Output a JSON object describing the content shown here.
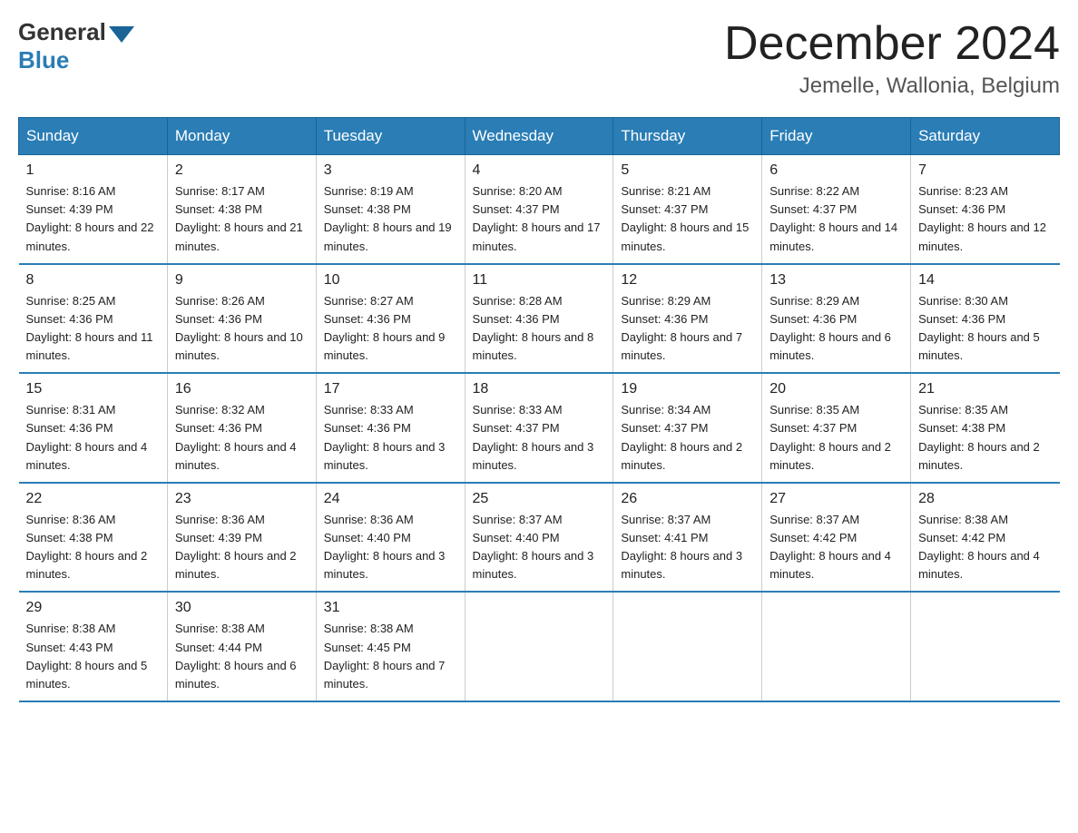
{
  "logo": {
    "general": "General",
    "blue": "Blue"
  },
  "title": "December 2024",
  "location": "Jemelle, Wallonia, Belgium",
  "days_of_week": [
    "Sunday",
    "Monday",
    "Tuesday",
    "Wednesday",
    "Thursday",
    "Friday",
    "Saturday"
  ],
  "weeks": [
    [
      {
        "day": "1",
        "sunrise": "8:16 AM",
        "sunset": "4:39 PM",
        "daylight": "8 hours and 22 minutes."
      },
      {
        "day": "2",
        "sunrise": "8:17 AM",
        "sunset": "4:38 PM",
        "daylight": "8 hours and 21 minutes."
      },
      {
        "day": "3",
        "sunrise": "8:19 AM",
        "sunset": "4:38 PM",
        "daylight": "8 hours and 19 minutes."
      },
      {
        "day": "4",
        "sunrise": "8:20 AM",
        "sunset": "4:37 PM",
        "daylight": "8 hours and 17 minutes."
      },
      {
        "day": "5",
        "sunrise": "8:21 AM",
        "sunset": "4:37 PM",
        "daylight": "8 hours and 15 minutes."
      },
      {
        "day": "6",
        "sunrise": "8:22 AM",
        "sunset": "4:37 PM",
        "daylight": "8 hours and 14 minutes."
      },
      {
        "day": "7",
        "sunrise": "8:23 AM",
        "sunset": "4:36 PM",
        "daylight": "8 hours and 12 minutes."
      }
    ],
    [
      {
        "day": "8",
        "sunrise": "8:25 AM",
        "sunset": "4:36 PM",
        "daylight": "8 hours and 11 minutes."
      },
      {
        "day": "9",
        "sunrise": "8:26 AM",
        "sunset": "4:36 PM",
        "daylight": "8 hours and 10 minutes."
      },
      {
        "day": "10",
        "sunrise": "8:27 AM",
        "sunset": "4:36 PM",
        "daylight": "8 hours and 9 minutes."
      },
      {
        "day": "11",
        "sunrise": "8:28 AM",
        "sunset": "4:36 PM",
        "daylight": "8 hours and 8 minutes."
      },
      {
        "day": "12",
        "sunrise": "8:29 AM",
        "sunset": "4:36 PM",
        "daylight": "8 hours and 7 minutes."
      },
      {
        "day": "13",
        "sunrise": "8:29 AM",
        "sunset": "4:36 PM",
        "daylight": "8 hours and 6 minutes."
      },
      {
        "day": "14",
        "sunrise": "8:30 AM",
        "sunset": "4:36 PM",
        "daylight": "8 hours and 5 minutes."
      }
    ],
    [
      {
        "day": "15",
        "sunrise": "8:31 AM",
        "sunset": "4:36 PM",
        "daylight": "8 hours and 4 minutes."
      },
      {
        "day": "16",
        "sunrise": "8:32 AM",
        "sunset": "4:36 PM",
        "daylight": "8 hours and 4 minutes."
      },
      {
        "day": "17",
        "sunrise": "8:33 AM",
        "sunset": "4:36 PM",
        "daylight": "8 hours and 3 minutes."
      },
      {
        "day": "18",
        "sunrise": "8:33 AM",
        "sunset": "4:37 PM",
        "daylight": "8 hours and 3 minutes."
      },
      {
        "day": "19",
        "sunrise": "8:34 AM",
        "sunset": "4:37 PM",
        "daylight": "8 hours and 2 minutes."
      },
      {
        "day": "20",
        "sunrise": "8:35 AM",
        "sunset": "4:37 PM",
        "daylight": "8 hours and 2 minutes."
      },
      {
        "day": "21",
        "sunrise": "8:35 AM",
        "sunset": "4:38 PM",
        "daylight": "8 hours and 2 minutes."
      }
    ],
    [
      {
        "day": "22",
        "sunrise": "8:36 AM",
        "sunset": "4:38 PM",
        "daylight": "8 hours and 2 minutes."
      },
      {
        "day": "23",
        "sunrise": "8:36 AM",
        "sunset": "4:39 PM",
        "daylight": "8 hours and 2 minutes."
      },
      {
        "day": "24",
        "sunrise": "8:36 AM",
        "sunset": "4:40 PM",
        "daylight": "8 hours and 3 minutes."
      },
      {
        "day": "25",
        "sunrise": "8:37 AM",
        "sunset": "4:40 PM",
        "daylight": "8 hours and 3 minutes."
      },
      {
        "day": "26",
        "sunrise": "8:37 AM",
        "sunset": "4:41 PM",
        "daylight": "8 hours and 3 minutes."
      },
      {
        "day": "27",
        "sunrise": "8:37 AM",
        "sunset": "4:42 PM",
        "daylight": "8 hours and 4 minutes."
      },
      {
        "day": "28",
        "sunrise": "8:38 AM",
        "sunset": "4:42 PM",
        "daylight": "8 hours and 4 minutes."
      }
    ],
    [
      {
        "day": "29",
        "sunrise": "8:38 AM",
        "sunset": "4:43 PM",
        "daylight": "8 hours and 5 minutes."
      },
      {
        "day": "30",
        "sunrise": "8:38 AM",
        "sunset": "4:44 PM",
        "daylight": "8 hours and 6 minutes."
      },
      {
        "day": "31",
        "sunrise": "8:38 AM",
        "sunset": "4:45 PM",
        "daylight": "8 hours and 7 minutes."
      },
      null,
      null,
      null,
      null
    ]
  ]
}
